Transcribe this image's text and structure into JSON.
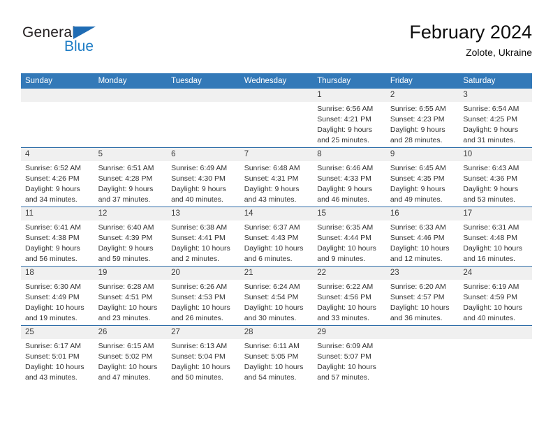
{
  "brand": {
    "name_primary": "General",
    "name_secondary": "Blue",
    "primary_color": "#231f20",
    "secondary_color": "#1f7dc5",
    "triangle_color": "#1f6cb4"
  },
  "header": {
    "title": "February 2024",
    "subtitle": "Zolote, Ukraine"
  },
  "calendar": {
    "header_background": "#3379b8",
    "header_text_color": "#ffffff",
    "daynum_background": "#f0f0f0",
    "row_separator_color": "#2e6da8",
    "weekday_headers": [
      "Sunday",
      "Monday",
      "Tuesday",
      "Wednesday",
      "Thursday",
      "Friday",
      "Saturday"
    ],
    "weeks": [
      [
        {
          "day": "",
          "blank": true,
          "sunrise": "",
          "sunset": "",
          "daylight_line1": "",
          "daylight_line2": ""
        },
        {
          "day": "",
          "blank": true,
          "sunrise": "",
          "sunset": "",
          "daylight_line1": "",
          "daylight_line2": ""
        },
        {
          "day": "",
          "blank": true,
          "sunrise": "",
          "sunset": "",
          "daylight_line1": "",
          "daylight_line2": ""
        },
        {
          "day": "",
          "blank": true,
          "sunrise": "",
          "sunset": "",
          "daylight_line1": "",
          "daylight_line2": ""
        },
        {
          "day": "1",
          "blank": false,
          "sunrise": "Sunrise: 6:56 AM",
          "sunset": "Sunset: 4:21 PM",
          "daylight_line1": "Daylight: 9 hours",
          "daylight_line2": "and 25 minutes."
        },
        {
          "day": "2",
          "blank": false,
          "sunrise": "Sunrise: 6:55 AM",
          "sunset": "Sunset: 4:23 PM",
          "daylight_line1": "Daylight: 9 hours",
          "daylight_line2": "and 28 minutes."
        },
        {
          "day": "3",
          "blank": false,
          "sunrise": "Sunrise: 6:54 AM",
          "sunset": "Sunset: 4:25 PM",
          "daylight_line1": "Daylight: 9 hours",
          "daylight_line2": "and 31 minutes."
        }
      ],
      [
        {
          "day": "4",
          "blank": false,
          "sunrise": "Sunrise: 6:52 AM",
          "sunset": "Sunset: 4:26 PM",
          "daylight_line1": "Daylight: 9 hours",
          "daylight_line2": "and 34 minutes."
        },
        {
          "day": "5",
          "blank": false,
          "sunrise": "Sunrise: 6:51 AM",
          "sunset": "Sunset: 4:28 PM",
          "daylight_line1": "Daylight: 9 hours",
          "daylight_line2": "and 37 minutes."
        },
        {
          "day": "6",
          "blank": false,
          "sunrise": "Sunrise: 6:49 AM",
          "sunset": "Sunset: 4:30 PM",
          "daylight_line1": "Daylight: 9 hours",
          "daylight_line2": "and 40 minutes."
        },
        {
          "day": "7",
          "blank": false,
          "sunrise": "Sunrise: 6:48 AM",
          "sunset": "Sunset: 4:31 PM",
          "daylight_line1": "Daylight: 9 hours",
          "daylight_line2": "and 43 minutes."
        },
        {
          "day": "8",
          "blank": false,
          "sunrise": "Sunrise: 6:46 AM",
          "sunset": "Sunset: 4:33 PM",
          "daylight_line1": "Daylight: 9 hours",
          "daylight_line2": "and 46 minutes."
        },
        {
          "day": "9",
          "blank": false,
          "sunrise": "Sunrise: 6:45 AM",
          "sunset": "Sunset: 4:35 PM",
          "daylight_line1": "Daylight: 9 hours",
          "daylight_line2": "and 49 minutes."
        },
        {
          "day": "10",
          "blank": false,
          "sunrise": "Sunrise: 6:43 AM",
          "sunset": "Sunset: 4:36 PM",
          "daylight_line1": "Daylight: 9 hours",
          "daylight_line2": "and 53 minutes."
        }
      ],
      [
        {
          "day": "11",
          "blank": false,
          "sunrise": "Sunrise: 6:41 AM",
          "sunset": "Sunset: 4:38 PM",
          "daylight_line1": "Daylight: 9 hours",
          "daylight_line2": "and 56 minutes."
        },
        {
          "day": "12",
          "blank": false,
          "sunrise": "Sunrise: 6:40 AM",
          "sunset": "Sunset: 4:39 PM",
          "daylight_line1": "Daylight: 9 hours",
          "daylight_line2": "and 59 minutes."
        },
        {
          "day": "13",
          "blank": false,
          "sunrise": "Sunrise: 6:38 AM",
          "sunset": "Sunset: 4:41 PM",
          "daylight_line1": "Daylight: 10 hours",
          "daylight_line2": "and 2 minutes."
        },
        {
          "day": "14",
          "blank": false,
          "sunrise": "Sunrise: 6:37 AM",
          "sunset": "Sunset: 4:43 PM",
          "daylight_line1": "Daylight: 10 hours",
          "daylight_line2": "and 6 minutes."
        },
        {
          "day": "15",
          "blank": false,
          "sunrise": "Sunrise: 6:35 AM",
          "sunset": "Sunset: 4:44 PM",
          "daylight_line1": "Daylight: 10 hours",
          "daylight_line2": "and 9 minutes."
        },
        {
          "day": "16",
          "blank": false,
          "sunrise": "Sunrise: 6:33 AM",
          "sunset": "Sunset: 4:46 PM",
          "daylight_line1": "Daylight: 10 hours",
          "daylight_line2": "and 12 minutes."
        },
        {
          "day": "17",
          "blank": false,
          "sunrise": "Sunrise: 6:31 AM",
          "sunset": "Sunset: 4:48 PM",
          "daylight_line1": "Daylight: 10 hours",
          "daylight_line2": "and 16 minutes."
        }
      ],
      [
        {
          "day": "18",
          "blank": false,
          "sunrise": "Sunrise: 6:30 AM",
          "sunset": "Sunset: 4:49 PM",
          "daylight_line1": "Daylight: 10 hours",
          "daylight_line2": "and 19 minutes."
        },
        {
          "day": "19",
          "blank": false,
          "sunrise": "Sunrise: 6:28 AM",
          "sunset": "Sunset: 4:51 PM",
          "daylight_line1": "Daylight: 10 hours",
          "daylight_line2": "and 23 minutes."
        },
        {
          "day": "20",
          "blank": false,
          "sunrise": "Sunrise: 6:26 AM",
          "sunset": "Sunset: 4:53 PM",
          "daylight_line1": "Daylight: 10 hours",
          "daylight_line2": "and 26 minutes."
        },
        {
          "day": "21",
          "blank": false,
          "sunrise": "Sunrise: 6:24 AM",
          "sunset": "Sunset: 4:54 PM",
          "daylight_line1": "Daylight: 10 hours",
          "daylight_line2": "and 30 minutes."
        },
        {
          "day": "22",
          "blank": false,
          "sunrise": "Sunrise: 6:22 AM",
          "sunset": "Sunset: 4:56 PM",
          "daylight_line1": "Daylight: 10 hours",
          "daylight_line2": "and 33 minutes."
        },
        {
          "day": "23",
          "blank": false,
          "sunrise": "Sunrise: 6:20 AM",
          "sunset": "Sunset: 4:57 PM",
          "daylight_line1": "Daylight: 10 hours",
          "daylight_line2": "and 36 minutes."
        },
        {
          "day": "24",
          "blank": false,
          "sunrise": "Sunrise: 6:19 AM",
          "sunset": "Sunset: 4:59 PM",
          "daylight_line1": "Daylight: 10 hours",
          "daylight_line2": "and 40 minutes."
        }
      ],
      [
        {
          "day": "25",
          "blank": false,
          "sunrise": "Sunrise: 6:17 AM",
          "sunset": "Sunset: 5:01 PM",
          "daylight_line1": "Daylight: 10 hours",
          "daylight_line2": "and 43 minutes."
        },
        {
          "day": "26",
          "blank": false,
          "sunrise": "Sunrise: 6:15 AM",
          "sunset": "Sunset: 5:02 PM",
          "daylight_line1": "Daylight: 10 hours",
          "daylight_line2": "and 47 minutes."
        },
        {
          "day": "27",
          "blank": false,
          "sunrise": "Sunrise: 6:13 AM",
          "sunset": "Sunset: 5:04 PM",
          "daylight_line1": "Daylight: 10 hours",
          "daylight_line2": "and 50 minutes."
        },
        {
          "day": "28",
          "blank": false,
          "sunrise": "Sunrise: 6:11 AM",
          "sunset": "Sunset: 5:05 PM",
          "daylight_line1": "Daylight: 10 hours",
          "daylight_line2": "and 54 minutes."
        },
        {
          "day": "29",
          "blank": false,
          "sunrise": "Sunrise: 6:09 AM",
          "sunset": "Sunset: 5:07 PM",
          "daylight_line1": "Daylight: 10 hours",
          "daylight_line2": "and 57 minutes."
        },
        {
          "day": "",
          "blank": true,
          "sunrise": "",
          "sunset": "",
          "daylight_line1": "",
          "daylight_line2": ""
        },
        {
          "day": "",
          "blank": true,
          "sunrise": "",
          "sunset": "",
          "daylight_line1": "",
          "daylight_line2": ""
        }
      ]
    ]
  }
}
